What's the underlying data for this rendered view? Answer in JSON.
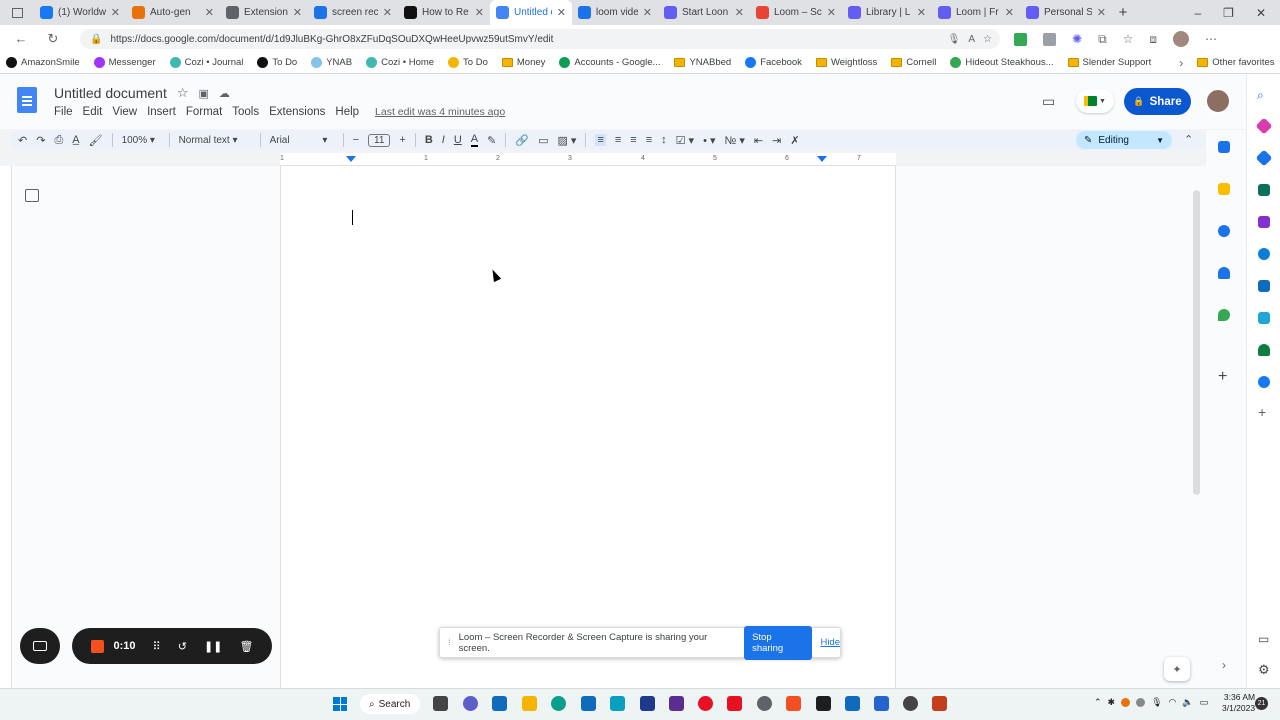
{
  "browser": {
    "tabs": [
      {
        "label": "(1) Worldw",
        "icon": "facebook-icon",
        "color": "#1877f2"
      },
      {
        "label": "Auto-gen",
        "icon": "app-icon",
        "color": "#e8710a"
      },
      {
        "label": "Extensions",
        "icon": "puzzle-icon",
        "color": "#5f6368"
      },
      {
        "label": "screen rec",
        "icon": "search-icon",
        "color": "#1a73e8"
      },
      {
        "label": "How to Re",
        "icon": "htg-icon",
        "color": "#111111"
      },
      {
        "label": "Untitled d",
        "icon": "docs-icon",
        "color": "#4285f4",
        "active": true
      },
      {
        "label": "loom vide",
        "icon": "search-icon",
        "color": "#1a73e8"
      },
      {
        "label": "Start Loon",
        "icon": "loom-icon",
        "color": "#625df5"
      },
      {
        "label": "Loom – Sc",
        "icon": "chrome-store-icon",
        "color": "#ea4335"
      },
      {
        "label": "Library | L",
        "icon": "loom-icon",
        "color": "#625df5"
      },
      {
        "label": "Loom | Fr",
        "icon": "loom-icon",
        "color": "#625df5"
      },
      {
        "label": "Personal S",
        "icon": "loom-icon",
        "color": "#625df5"
      }
    ],
    "url": "https://docs.google.com/document/d/1d9JluBKg-GhrO8xZFuDqSOuDXQwHeeUpvwz59utSmvY/edit",
    "bookmarks": [
      {
        "label": "AmazonSmile",
        "type": "amazon"
      },
      {
        "label": "Messenger",
        "type": "messenger"
      },
      {
        "label": "Cozi • Journal",
        "type": "cozi"
      },
      {
        "label": "To Do",
        "type": "notion"
      },
      {
        "label": "YNAB",
        "type": "ynab"
      },
      {
        "label": "Cozi • Home",
        "type": "cozi"
      },
      {
        "label": "To Do",
        "type": "todo"
      },
      {
        "label": "Money",
        "type": "folder"
      },
      {
        "label": "Accounts - Google...",
        "type": "sheets"
      },
      {
        "label": "YNABbed",
        "type": "folder"
      },
      {
        "label": "Facebook",
        "type": "facebook"
      },
      {
        "label": "Weightloss",
        "type": "folder"
      },
      {
        "label": "Cornell",
        "type": "folder"
      },
      {
        "label": "Hideout Steakhous...",
        "type": "site"
      },
      {
        "label": "Slender Support",
        "type": "folder"
      }
    ],
    "other_favorites": "Other favorites"
  },
  "docs": {
    "title": "Untitled document",
    "menu": [
      "File",
      "Edit",
      "View",
      "Insert",
      "Format",
      "Tools",
      "Extensions",
      "Help"
    ],
    "last_edit": "Last edit was 4 minutes ago",
    "share_label": "Share",
    "toolbar": {
      "zoom": "100%",
      "style": "Normal text",
      "font": "Arial",
      "font_size": "11",
      "mode": "Editing"
    },
    "ruler_numbers": [
      "1",
      "1",
      "2",
      "3",
      "4",
      "5",
      "6",
      "7"
    ]
  },
  "loom": {
    "timer": "0:10",
    "share_message": "Loom – Screen Recorder & Screen Capture is sharing your screen.",
    "stop_label": "Stop sharing",
    "hide_label": "Hide"
  },
  "taskbar": {
    "search_label": "Search",
    "time": "3:36 AM",
    "date": "3/1/2023",
    "notification_count": "21"
  }
}
